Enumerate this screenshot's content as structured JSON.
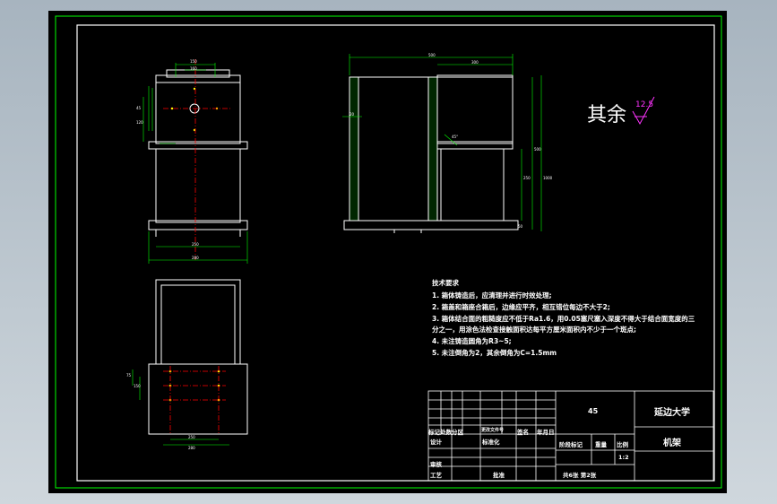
{
  "rough_note": {
    "label": "其余",
    "value": "12.5"
  },
  "tech_req": {
    "title": "技术要求",
    "lines": [
      "1. 箱体铸造后，应清理并进行时效处理;",
      "2. 箱盖和箱座合箱后，边缘应平齐，相互错位每边不大于2;",
      "3. 箱体结合面的粗糙度应不低于Ra1.6，用0.05塞尺塞入深度不得大于结合面宽度的三",
      "分之一，用涂色法检查接触面积达每平方厘米面积内不少于一个斑点;",
      "4. 未注铸造圆角为R3~5;",
      "5. 未注倒角为2，其余倒角为C=1.5mm"
    ]
  },
  "title_block": {
    "material": "45",
    "school": "延边大学",
    "part_name": "机架",
    "scale": "1:2",
    "sheets": "共6张 第2张",
    "row_labels": {
      "mark": "标记处数分区",
      "doc": "更改文件号",
      "sign": "签名",
      "date": "年月日",
      "design": "设计",
      "std": "标准化",
      "stage": "阶段标记",
      "weight": "重量",
      "ratio": "比例",
      "review": "审核",
      "craft": "工艺",
      "approve": "批准"
    }
  },
  "dims": {
    "top_left": [
      "150",
      "160"
    ],
    "left_side": [
      "45",
      "120"
    ],
    "bottom_left": [
      "250",
      "280"
    ],
    "elev_top": [
      "500",
      "300"
    ],
    "elev_right": [
      "250",
      "500",
      "1000"
    ],
    "elev_left": "20",
    "elev_inner": "45°",
    "elev_bot": "50",
    "plan_left": [
      "75",
      "150"
    ],
    "plan_bot": [
      "250",
      "280"
    ]
  },
  "colors": {
    "border": "#00ff00",
    "paper": "#000000",
    "line": "#ffffff",
    "dim": "#00ff00",
    "center": "#ff0000",
    "accent": "#ff33ff",
    "hole": "#ffff00"
  }
}
